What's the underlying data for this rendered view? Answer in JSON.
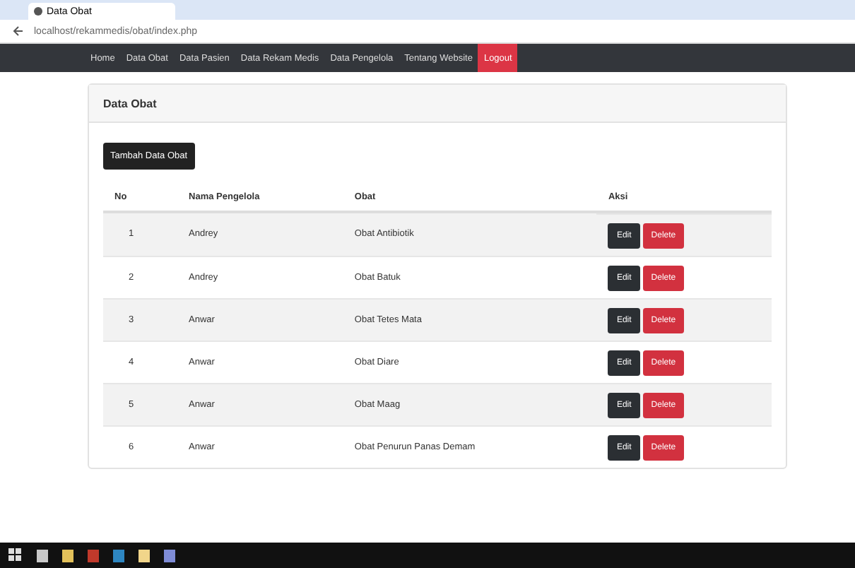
{
  "browser": {
    "tab_title": "Data Obat",
    "url": "localhost/rekammedis/obat/index.php"
  },
  "nav": [
    {
      "label": "Home",
      "kind": "link"
    },
    {
      "label": "Data Obat",
      "kind": "link"
    },
    {
      "label": "Data Pasien",
      "kind": "link"
    },
    {
      "label": "Data Rekam Medis",
      "kind": "link"
    },
    {
      "label": "Data Pengelola",
      "kind": "link"
    },
    {
      "label": "Tentang Website",
      "kind": "link"
    },
    {
      "label": "Logout",
      "kind": "danger"
    }
  ],
  "card": {
    "title": "Data Obat",
    "add_button": "Tambah Data Obat"
  },
  "table": {
    "columns": [
      "No",
      "Nama Pengelola",
      "Obat",
      "Aksi"
    ],
    "rows": [
      {
        "no": "1",
        "name": "Andrey",
        "obat": "Obat Antibiotik",
        "edit": "Edit",
        "delete": "Delete"
      },
      {
        "no": "2",
        "name": "Andrey",
        "obat": "Obat Batuk",
        "edit": "Edit",
        "delete": "Delete"
      },
      {
        "no": "3",
        "name": "Anwar",
        "obat": "Obat Tetes Mata",
        "edit": "Edit",
        "delete": "Delete"
      },
      {
        "no": "4",
        "name": "Anwar",
        "obat": "Obat Diare",
        "edit": "Edit",
        "delete": "Delete"
      },
      {
        "no": "5",
        "name": "Anwar",
        "obat": "Obat Maag",
        "edit": "Edit",
        "delete": "Delete"
      },
      {
        "no": "6",
        "name": "Anwar",
        "obat": "Obat Penurun Panas Demam",
        "edit": "Edit",
        "delete": "Delete"
      }
    ]
  }
}
